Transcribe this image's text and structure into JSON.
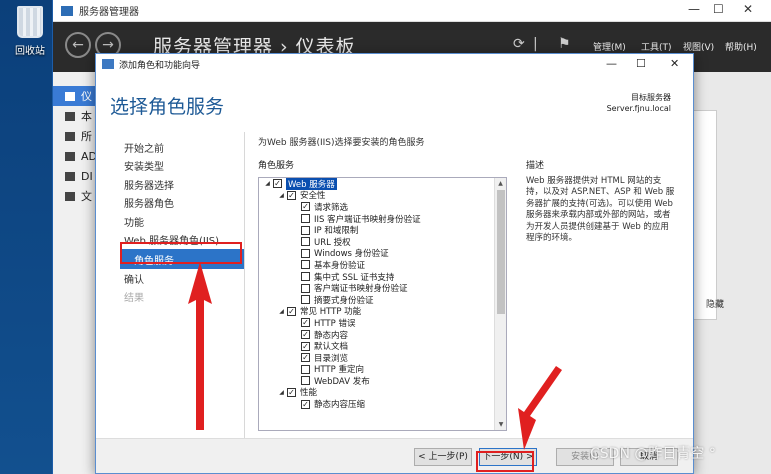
{
  "desktop": {
    "recycle_label": "回收站"
  },
  "server_manager": {
    "window_title": "服务器管理器",
    "breadcrumb": "服务器管理器 › 仪表板",
    "menus": [
      "管理(M)",
      "工具(T)",
      "视图(V)",
      "帮助(H)"
    ],
    "sidebar_items": [
      "仪",
      "本",
      "所",
      "AD",
      "DI",
      "文"
    ],
    "tile_text": "隐藏"
  },
  "wizard": {
    "window_title": "添加角色和功能向导",
    "heading": "选择角色服务",
    "destination_label": "目标服务器",
    "destination_server": "Server.fjnu.local",
    "nav": [
      {
        "label": "开始之前",
        "state": "normal"
      },
      {
        "label": "安装类型",
        "state": "normal"
      },
      {
        "label": "服务器选择",
        "state": "normal"
      },
      {
        "label": "服务器角色",
        "state": "normal"
      },
      {
        "label": "功能",
        "state": "normal"
      },
      {
        "label": "Web 服务器角色(IIS)",
        "state": "normal"
      },
      {
        "label": "角色服务",
        "state": "active"
      },
      {
        "label": "确认",
        "state": "normal"
      },
      {
        "label": "结果",
        "state": "disabled"
      }
    ],
    "instruction": "为Web 服务器(IIS)选择要安装的角色服务",
    "role_services_label": "角色服务",
    "tree": [
      {
        "level": 0,
        "expander": "◢",
        "checked": true,
        "label": "Web 服务器",
        "selected": true
      },
      {
        "level": 1,
        "expander": "◢",
        "checked": true,
        "label": "安全性"
      },
      {
        "level": 2,
        "expander": "",
        "checked": true,
        "label": "请求筛选"
      },
      {
        "level": 2,
        "expander": "",
        "checked": false,
        "label": "IIS 客户端证书映射身份验证"
      },
      {
        "level": 2,
        "expander": "",
        "checked": false,
        "label": "IP 和域限制"
      },
      {
        "level": 2,
        "expander": "",
        "checked": false,
        "label": "URL 授权"
      },
      {
        "level": 2,
        "expander": "",
        "checked": false,
        "label": "Windows 身份验证"
      },
      {
        "level": 2,
        "expander": "",
        "checked": false,
        "label": "基本身份验证"
      },
      {
        "level": 2,
        "expander": "",
        "checked": false,
        "label": "集中式 SSL 证书支持"
      },
      {
        "level": 2,
        "expander": "",
        "checked": false,
        "label": "客户端证书映射身份验证"
      },
      {
        "level": 2,
        "expander": "",
        "checked": false,
        "label": "摘要式身份验证"
      },
      {
        "level": 1,
        "expander": "◢",
        "checked": true,
        "label": "常见 HTTP 功能"
      },
      {
        "level": 2,
        "expander": "",
        "checked": true,
        "label": "HTTP 错误"
      },
      {
        "level": 2,
        "expander": "",
        "checked": true,
        "label": "静态内容"
      },
      {
        "level": 2,
        "expander": "",
        "checked": true,
        "label": "默认文档"
      },
      {
        "level": 2,
        "expander": "",
        "checked": true,
        "label": "目录浏览"
      },
      {
        "level": 2,
        "expander": "",
        "checked": false,
        "label": "HTTP 重定向"
      },
      {
        "level": 2,
        "expander": "",
        "checked": false,
        "label": "WebDAV 发布"
      },
      {
        "level": 1,
        "expander": "◢",
        "checked": true,
        "label": "性能"
      },
      {
        "level": 2,
        "expander": "",
        "checked": true,
        "label": "静态内容压缩"
      }
    ],
    "description_label": "描述",
    "description": "Web 服务器提供对 HTML 网站的支持，以及对 ASP.NET、ASP 和 Web 服务器扩展的支持(可选)。可以使用 Web 服务器来承载内部或外部的网站，或者为开发人员提供创建基于 Web 的应用程序的环境。",
    "buttons": {
      "prev": "< 上一步(P)",
      "next": "下一步(N) >",
      "install": "安装(I)",
      "cancel": "取消"
    }
  },
  "watermark": "CSDN @昨日青空 °",
  "colors": {
    "accent": "#2c74c8",
    "title_blue": "#1e5a96",
    "annotation_red": "#e02020"
  }
}
